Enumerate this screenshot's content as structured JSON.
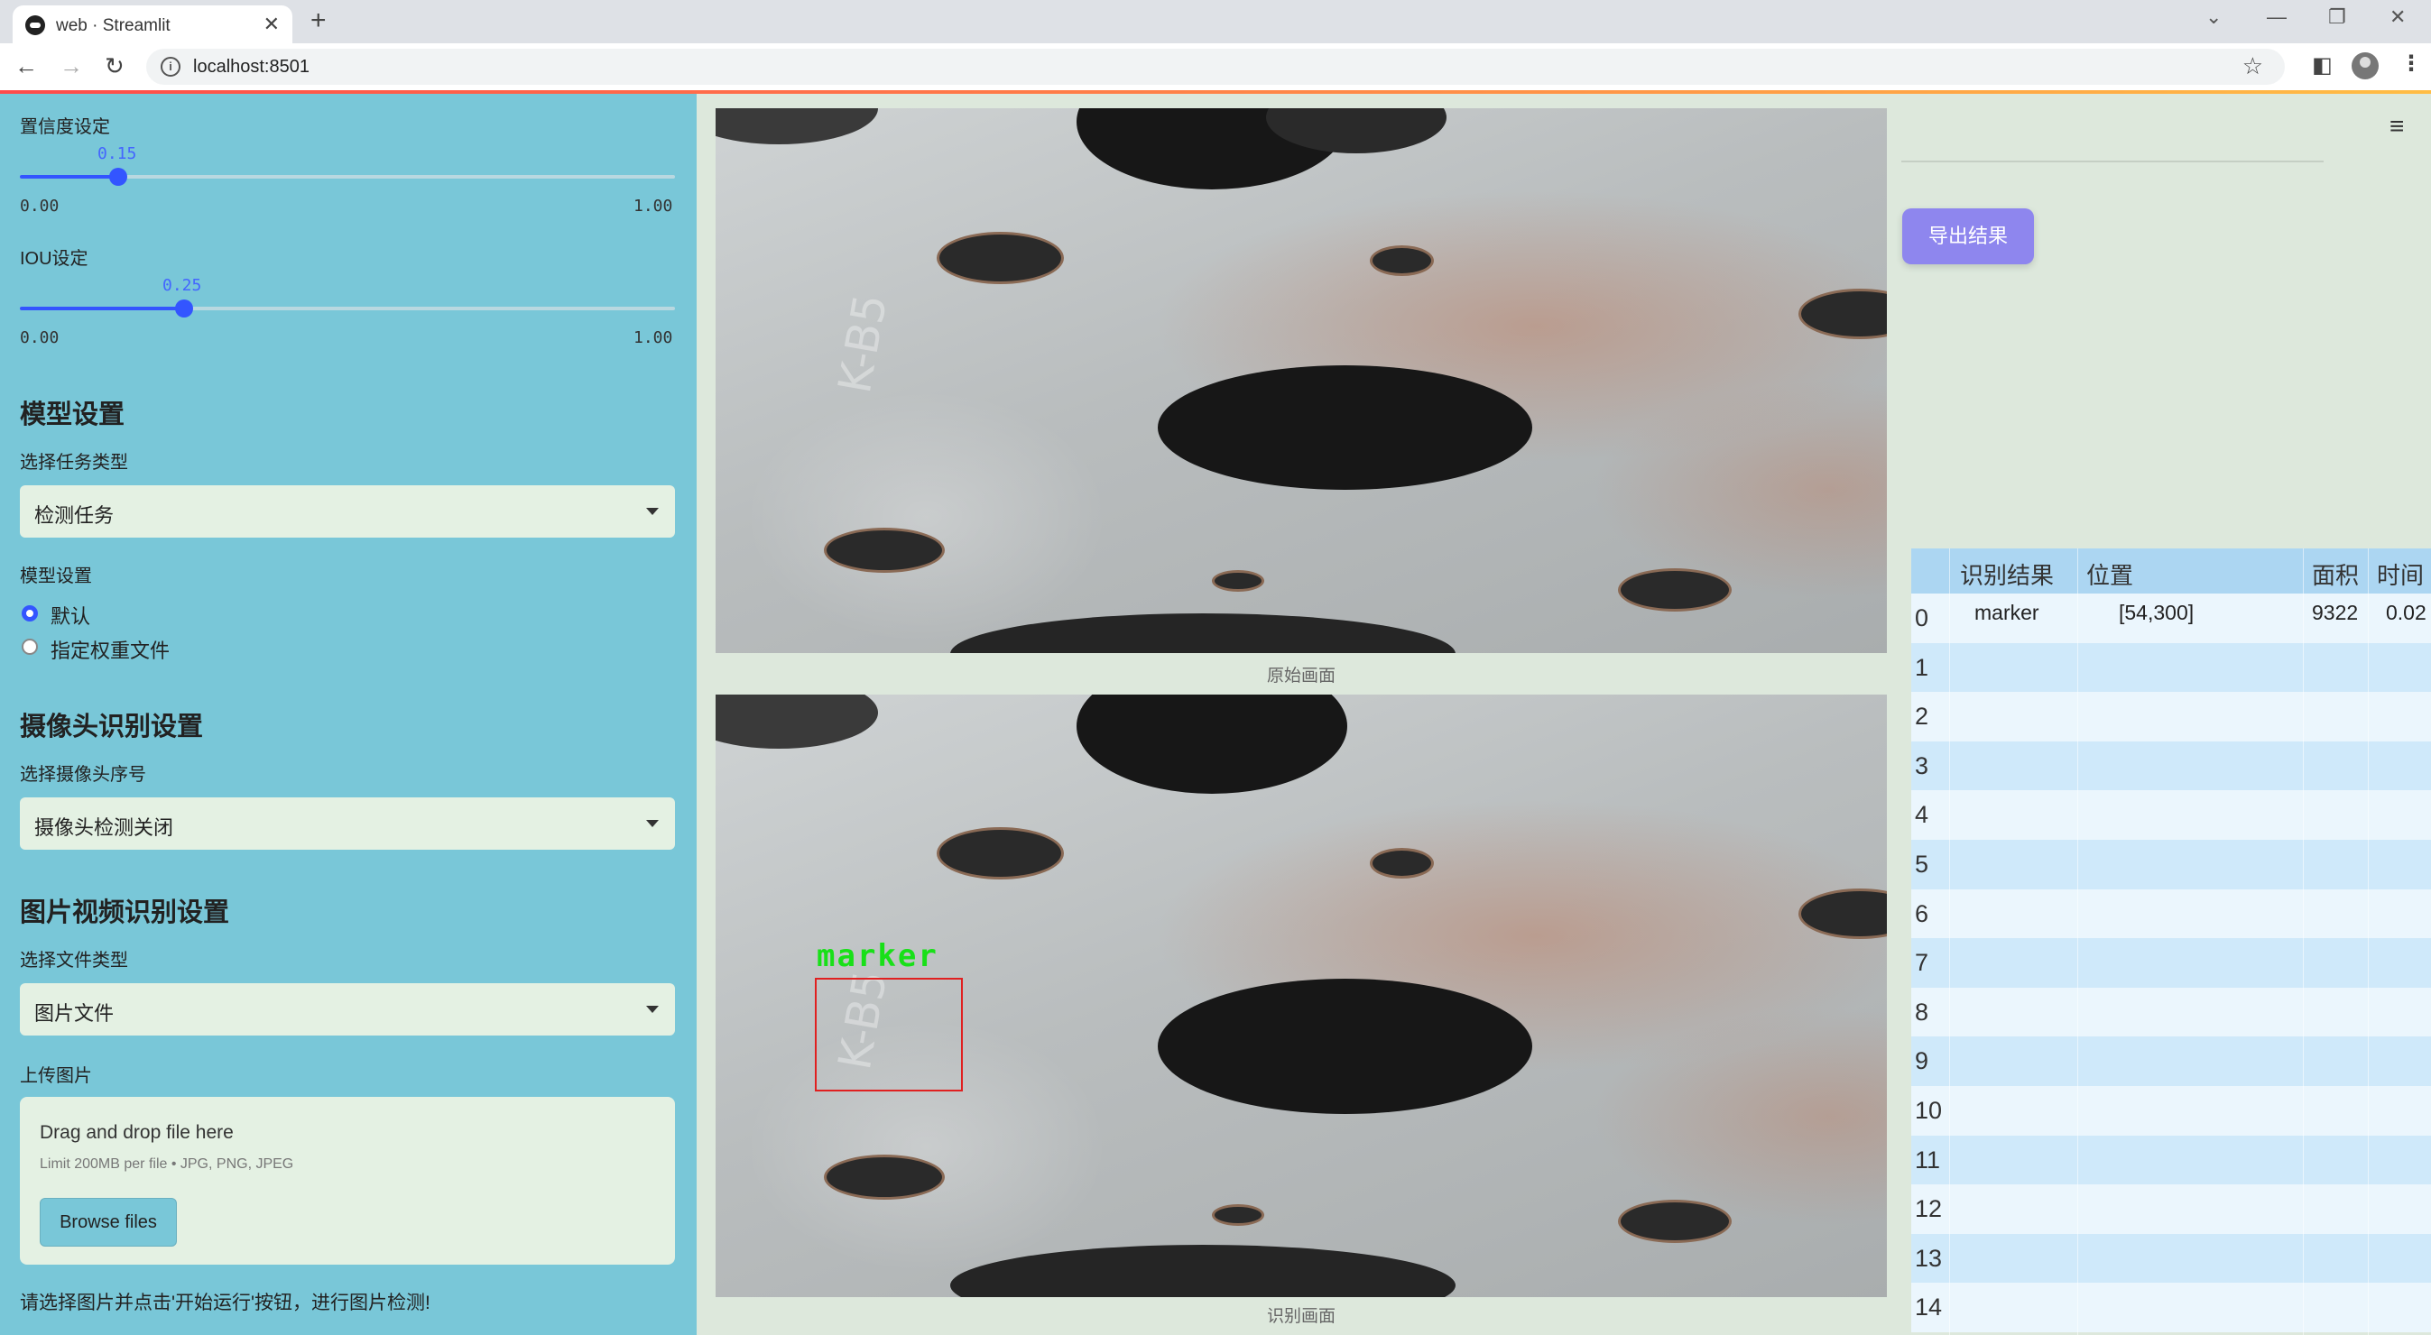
{
  "browser": {
    "tab_title": "web · Streamlit",
    "new_tab": "+",
    "url": "localhost:8501"
  },
  "sidebar": {
    "confidence": {
      "label": "置信度设定",
      "value_text": "0.15",
      "value": 0.15,
      "min": "0.00",
      "max": "1.00"
    },
    "iou": {
      "label": "IOU设定",
      "value_text": "0.25",
      "value": 0.25,
      "min": "0.00",
      "max": "1.00"
    },
    "model_heading": "模型设置",
    "task_label": "选择任务类型",
    "task_value": "检测任务",
    "model_label": "模型设置",
    "model_options": [
      "默认",
      "指定权重文件"
    ],
    "camera_heading": "摄像头识别设置",
    "camera_label": "选择摄像头序号",
    "camera_value": "摄像头检测关闭",
    "file_heading": "图片视频识别设置",
    "file_type_label": "选择文件类型",
    "file_type_value": "图片文件",
    "upload_label": "上传图片",
    "upload_title": "Drag and drop file here",
    "upload_limit": "Limit 200MB per file • JPG, PNG, JPEG",
    "browse_label": "Browse files",
    "hint": "请选择图片并点击'开始运行'按钮，进行图片检测!"
  },
  "main": {
    "caption_original": "原始画面",
    "caption_detected": "识别画面",
    "image_text": "K-B5",
    "detection_label": "marker"
  },
  "right": {
    "export_label": "导出结果",
    "table": {
      "headers": [
        "识别结果",
        "位置",
        "面积",
        "时间"
      ],
      "rows": [
        {
          "index": "0",
          "result": "marker",
          "position": "[54,300]",
          "area": "9322",
          "time": "0.02"
        },
        {
          "index": "1"
        },
        {
          "index": "2"
        },
        {
          "index": "3"
        },
        {
          "index": "4"
        },
        {
          "index": "5"
        },
        {
          "index": "6"
        },
        {
          "index": "7"
        },
        {
          "index": "8"
        },
        {
          "index": "9"
        },
        {
          "index": "10"
        },
        {
          "index": "11"
        },
        {
          "index": "12"
        },
        {
          "index": "13"
        },
        {
          "index": "14"
        }
      ]
    }
  },
  "colors": {
    "sidebar": "#79c7d8",
    "accent": "#3355ff",
    "export": "#8e86ee",
    "detection_box": "#e02020",
    "detection_label": "#18e018"
  }
}
